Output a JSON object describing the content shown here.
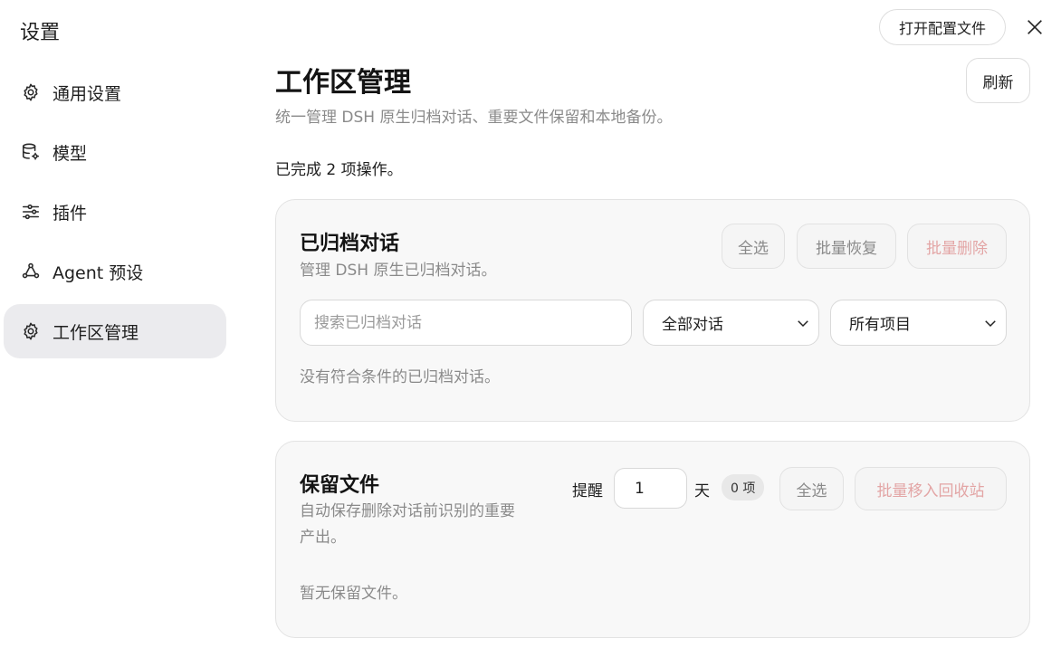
{
  "app": {
    "title": "设置"
  },
  "sidebar": {
    "items": [
      {
        "label": "通用设置",
        "icon": "gear-icon",
        "active": false
      },
      {
        "label": "模型",
        "icon": "database-gear-icon",
        "active": false
      },
      {
        "label": "插件",
        "icon": "sliders-icon",
        "active": false
      },
      {
        "label": "Agent 预设",
        "icon": "nodes-icon",
        "active": false
      },
      {
        "label": "工作区管理",
        "icon": "gear-icon",
        "active": true
      }
    ]
  },
  "header": {
    "open_config_label": "打开配置文件",
    "close_icon": "close-icon"
  },
  "main": {
    "title": "工作区管理",
    "subtitle": "统一管理 DSH 原生归档对话、重要文件保留和本地备份。",
    "refresh_label": "刷新",
    "status": "已完成 2 项操作。"
  },
  "archived": {
    "title": "已归档对话",
    "description": "管理 DSH 原生已归档对话。",
    "select_all_label": "全选",
    "batch_restore_label": "批量恢复",
    "batch_delete_label": "批量删除",
    "search_placeholder": "搜索已归档对话",
    "search_value": "",
    "filter_conversation": "全部对话",
    "filter_project": "所有项目",
    "empty_text": "没有符合条件的已归档对话。"
  },
  "kept": {
    "title": "保留文件",
    "description_line1": "自动保存删除对话前识别的重要",
    "description_line2": "产出。",
    "remind_label": "提醒",
    "days_value": "1",
    "day_unit": "天",
    "count_badge": "0 项",
    "select_all_label": "全选",
    "move_to_trash_label": "批量移入回收站",
    "empty_text": "暂无保留文件。"
  },
  "colors": {
    "active_nav_bg": "#ebebee",
    "card_bg": "#f8f8f8",
    "danger_text": "#e3a5a5",
    "muted_text": "#8a8a8a"
  }
}
